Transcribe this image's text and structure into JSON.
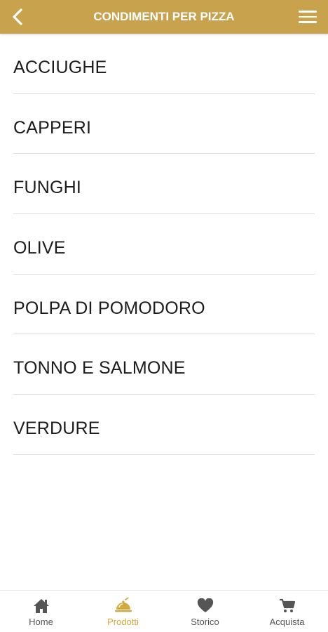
{
  "header": {
    "title": "CONDIMENTI PER PIZZA",
    "back_icon": "chevron-left-icon",
    "menu_icon": "hamburger-menu-icon",
    "background_color": "#c9a24e"
  },
  "list": {
    "items": [
      {
        "label": "ACCIUGHE"
      },
      {
        "label": "CAPPERI"
      },
      {
        "label": "FUNGHI"
      },
      {
        "label": "OLIVE"
      },
      {
        "label": "POLPA DI POMODORO"
      },
      {
        "label": "TONNO E SALMONE"
      },
      {
        "label": "VERDURE"
      }
    ]
  },
  "bottom_nav": {
    "active_color": "#d4a93b",
    "inactive_color": "#555555",
    "items": [
      {
        "label": "Home",
        "icon": "home-icon",
        "active": false
      },
      {
        "label": "Prodotti",
        "icon": "food-dome-icon",
        "active": true
      },
      {
        "label": "Storico",
        "icon": "heart-icon",
        "active": false
      },
      {
        "label": "Acquista",
        "icon": "cart-icon",
        "active": false
      }
    ]
  }
}
